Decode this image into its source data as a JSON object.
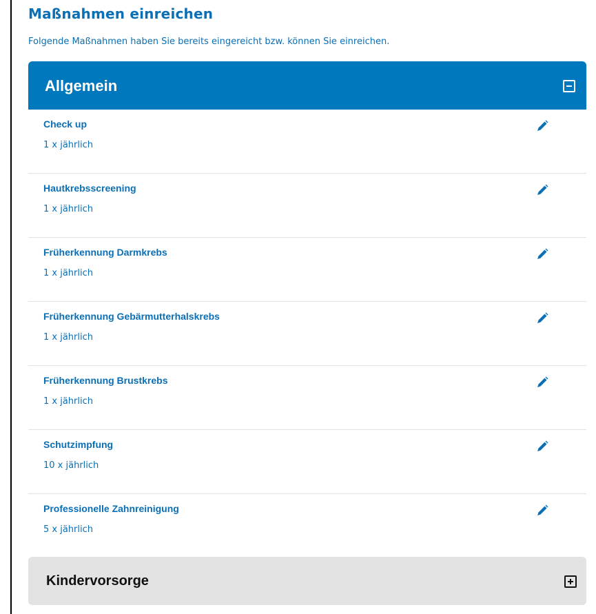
{
  "page": {
    "title": "Maßnahmen einreichen",
    "subtitle": "Folgende Maßnahmen haben Sie bereits eingereicht bzw. können Sie einreichen."
  },
  "sections": [
    {
      "title": "Allgemein",
      "expanded": true,
      "toggle_icon": "minus-square-icon",
      "items": [
        {
          "title": "Check up",
          "frequency": "1 x jährlich",
          "action_icon": "pencil-icon"
        },
        {
          "title": "Hautkrebsscreening",
          "frequency": "1 x jährlich",
          "action_icon": "pencil-icon"
        },
        {
          "title": "Früherkennung Darmkrebs",
          "frequency": "1 x jährlich",
          "action_icon": "pencil-icon"
        },
        {
          "title": "Früherkennung Gebärmutterhalskrebs",
          "frequency": "1 x jährlich",
          "action_icon": "pencil-icon"
        },
        {
          "title": "Früherkennung Brustkrebs",
          "frequency": "1 x jährlich",
          "action_icon": "pencil-icon"
        },
        {
          "title": "Schutzimpfung",
          "frequency": "10 x jährlich",
          "action_icon": "pencil-icon"
        },
        {
          "title": "Professionelle Zahnreinigung",
          "frequency": "5 x jährlich",
          "action_icon": "pencil-icon"
        }
      ]
    },
    {
      "title": "Kindervorsorge",
      "expanded": false,
      "toggle_icon": "plus-square-icon"
    }
  ],
  "colors": {
    "accent": "#0078be",
    "text_blue": "#0a6fb5",
    "collapsed_bg": "#e3e3e3"
  }
}
